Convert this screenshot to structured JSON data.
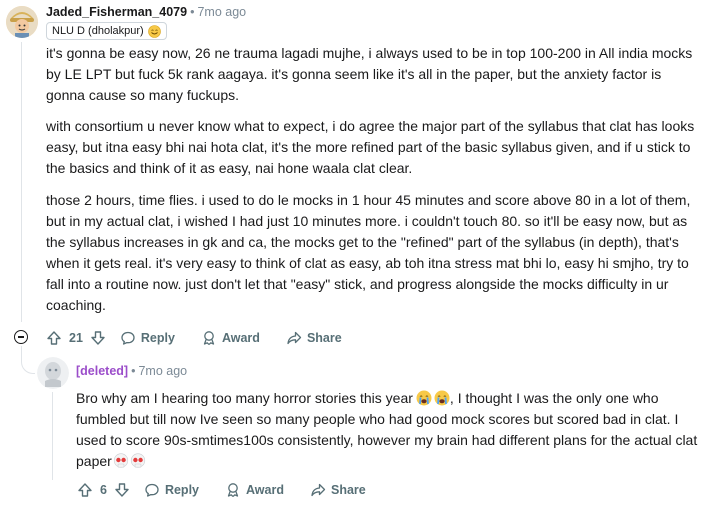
{
  "comment1": {
    "author": "Jaded_Fisherman_4079",
    "time": "7mo ago",
    "flair": "NLU D (dholakpur)",
    "paragraphs": [
      "it's gonna be easy now, 26 ne trauma lagadi mujhe, i always used to be in top 100-200 in All india mocks by LE LPT but fuck 5k rank aagaya. it's gonna seem like it's all in the paper, but the anxiety factor is gonna cause so many fuckups.",
      "with consortium u never know what to expect, i do agree the major part of the syllabus that clat has looks easy, but itna easy bhi nai hota clat, it's the more refined part of the basic syllabus given, and if u stick to the basics and think of it as easy, nai hone waala clat clear.",
      "those 2 hours, time flies. i used to do le mocks in 1 hour 45 minutes and score above 80 in a lot of them, but in my actual clat, i wished I had just 10 minutes more. i couldn't touch 80. so it'll be easy now, but as the syllabus increases in gk and ca, the mocks get to the \"refined\" part of the syllabus (in depth), that's when it gets real. it's very easy to think of clat as easy, ab toh itna stress mat bhi lo, easy hi smjho, try to fall into a routine now. just don't let that \"easy\" stick, and progress alongside the mocks difficulty in ur coaching."
    ],
    "votes": "21",
    "reply_label": "Reply",
    "award_label": "Award",
    "share_label": "Share"
  },
  "comment2": {
    "author": "[deleted]",
    "time": "7mo ago",
    "text_1": "Bro why am I hearing too many horror stories this year",
    "text_2": ", I thought I was the only one who fumbled but till now Ive seen so many people who had good mock scores but scored bad in clat. I used to score 90s-smtimes100s consistently, however my brain had different plans for the actual clat paper",
    "votes": "6",
    "reply_label": "Reply",
    "award_label": "Award",
    "share_label": "Share"
  },
  "colors": {
    "author_deleted": "#9b4dca",
    "meta": "#7c8a96",
    "action": "#576f76"
  },
  "icons": [
    "upvote-icon",
    "downvote-icon",
    "reply-icon",
    "award-icon",
    "share-icon",
    "collapse-icon",
    "crying-emoji-icon",
    "skull-emoji-icon"
  ]
}
